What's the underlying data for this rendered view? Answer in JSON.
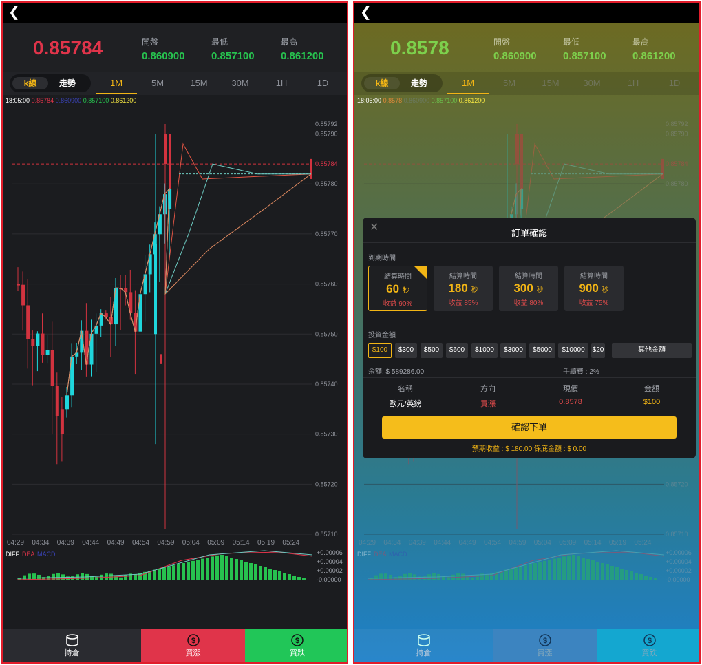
{
  "header": {
    "price": "0.85784",
    "open_label": "開盤",
    "open": "0.860900",
    "low_label": "最低",
    "low": "0.857100",
    "high_label": "最高",
    "high": "0.861200"
  },
  "header_right": {
    "price": "0.8578"
  },
  "segment": {
    "kline": "k線",
    "trend": "走勢"
  },
  "timeframes": [
    "1M",
    "5M",
    "15M",
    "30M",
    "1H",
    "1D"
  ],
  "legend": {
    "time": "18:05:00",
    "close": "0.85784",
    "close_right": "0.8578",
    "open": "0.860900",
    "low": "0.857100",
    "high": "0.861200"
  },
  "price_axis": [
    "0.85792",
    "0.85790",
    "0.85780",
    "0.85770",
    "0.85760",
    "0.85750",
    "0.85740",
    "0.85730",
    "0.85720",
    "0.85710"
  ],
  "current_price_tag": "0.85784",
  "time_axis": [
    "04:29",
    "04:34",
    "04:39",
    "04:44",
    "04:49",
    "04:54",
    "04:59",
    "05:04",
    "05:09",
    "05:14",
    "05:19",
    "05:24"
  ],
  "macd": {
    "diff_label": "DIFF:",
    "dea_label": "DEA:",
    "macd_label": "MACD",
    "axis": [
      "+0.00006",
      "+0.00004",
      "+0.00002",
      "-0.00000"
    ]
  },
  "bottom_nav": {
    "positions": "持倉",
    "buy_up": "買漲",
    "buy_down": "買跌"
  },
  "modal": {
    "title": "訂單確認",
    "expiry_label": "到期時間",
    "cards": [
      {
        "head": "結算時間",
        "seconds": "60",
        "unit": "秒",
        "profit": "收益 90%"
      },
      {
        "head": "結算時間",
        "seconds": "180",
        "unit": "秒",
        "profit": "收益 85%"
      },
      {
        "head": "結算時間",
        "seconds": "300",
        "unit": "秒",
        "profit": "收益 80%"
      },
      {
        "head": "結算時間",
        "seconds": "900",
        "unit": "秒",
        "profit": "收益 75%"
      }
    ],
    "amount_label": "投資金額",
    "amounts": [
      "$100",
      "$300",
      "$500",
      "$600",
      "$1000",
      "$3000",
      "$5000",
      "$10000",
      "$20"
    ],
    "other_amount": "其他金額",
    "balance": "余額: $ 589286.00",
    "fee": "手續費 : 2%",
    "cols": {
      "name": "名稱",
      "direction": "方向",
      "price": "現價",
      "amount": "金額"
    },
    "values": {
      "name": "歐元/英鎊",
      "direction": "買漲",
      "price": "0.8578",
      "amount": "$100"
    },
    "confirm": "確認下單",
    "expected": "預期收益 : $ 180.00    保底金額 : $ 0.00"
  },
  "colors": {
    "up": "#e0344a",
    "down": "#27c24f",
    "accent": "#f2b515",
    "candle_up": "#1fd6dc",
    "candle_down": "#d2333f"
  },
  "chart_data": {
    "type": "candlestick",
    "price_range": [
      0.8571,
      0.85792
    ],
    "last_price": 0.85784
  }
}
